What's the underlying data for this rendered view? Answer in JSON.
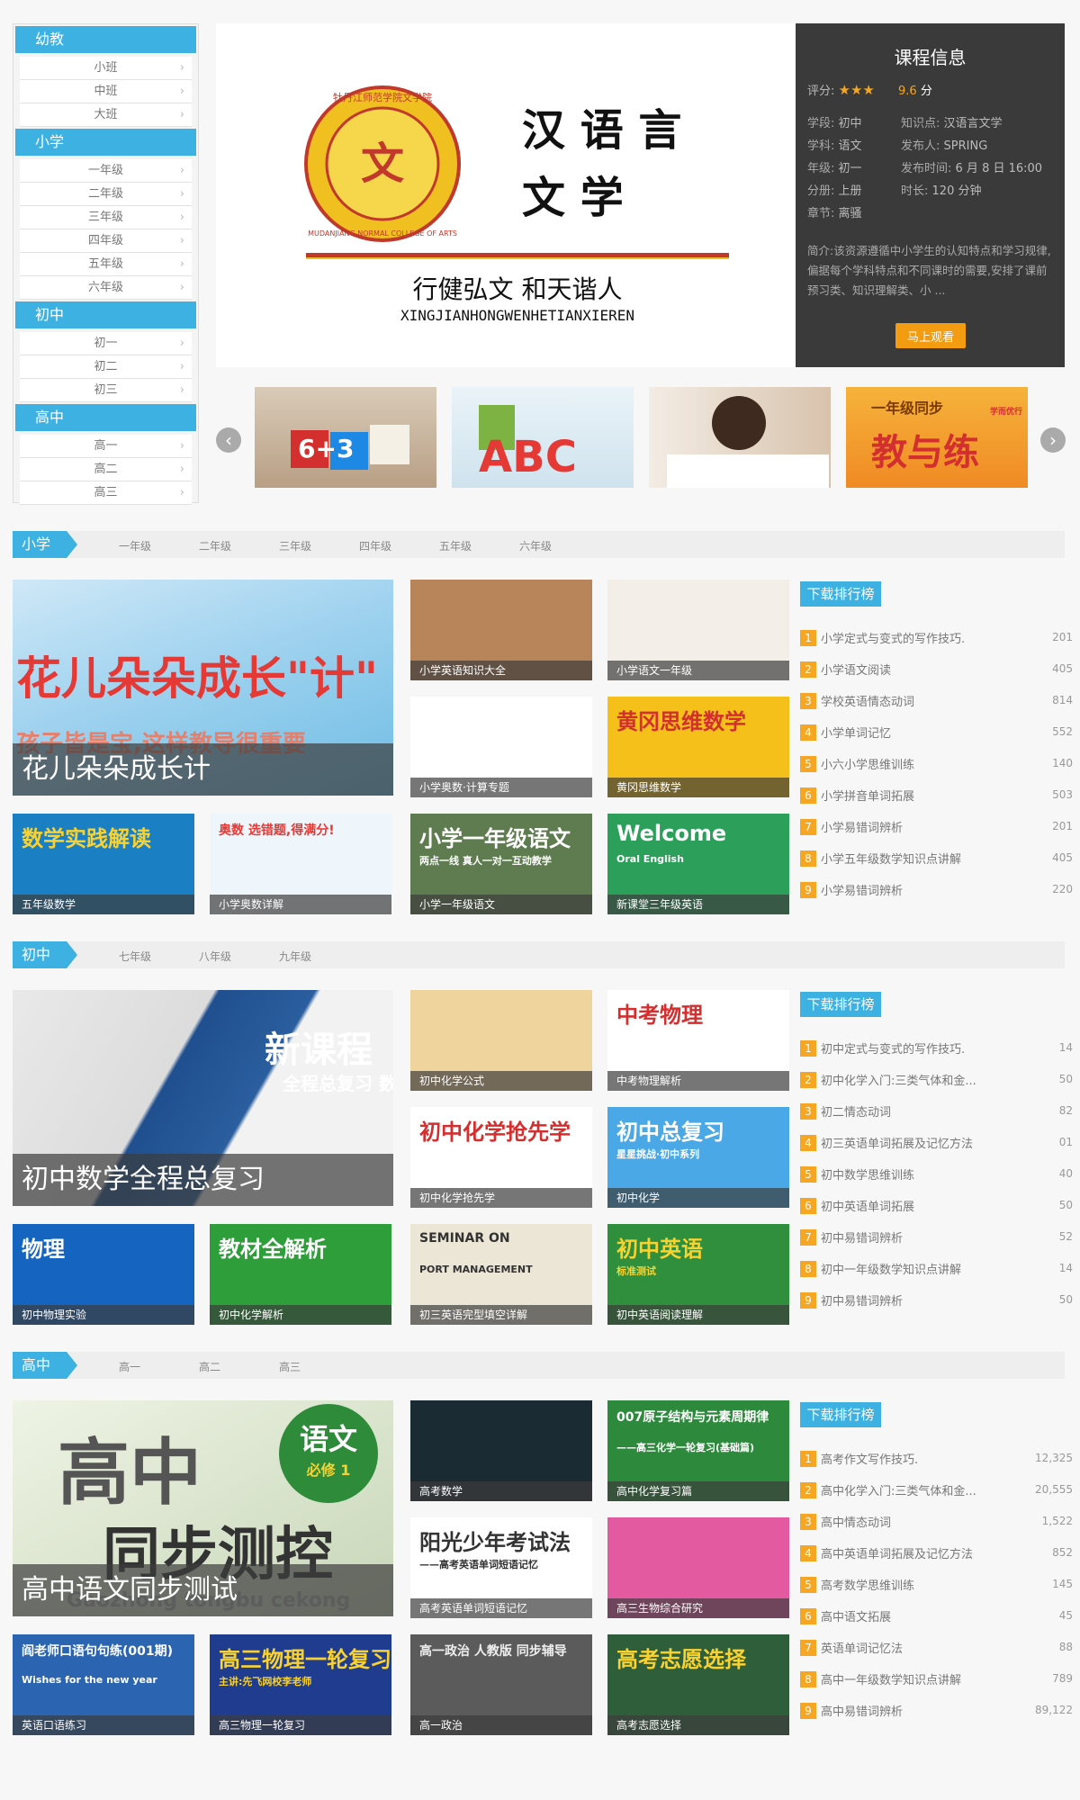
{
  "sidebar": {
    "groups": [
      {
        "title": "幼教",
        "items": [
          "小班",
          "中班",
          "大班"
        ]
      },
      {
        "title": "小学",
        "items": [
          "一年级",
          "二年级",
          "三年级",
          "四年级",
          "五年级",
          "六年级"
        ]
      },
      {
        "title": "初中",
        "items": [
          "初一",
          "初二",
          "初三"
        ]
      },
      {
        "title": "高中",
        "items": [
          "高一",
          "高二",
          "高三"
        ]
      }
    ]
  },
  "banner": {
    "seal_text": "牡丹江师范学院文学院",
    "seal_en": "MUDANJIANG NORMAL COLLEGE OF ARTS",
    "title_line1": "汉 语 言",
    "title_line2": "文      学",
    "motto": "行健弘文 和天谐人",
    "motto_pinyin": "XINGJIANHONGWENHETIANXIEREN"
  },
  "course": {
    "title": "课程信息",
    "rating_label": "评分:",
    "stars": "★★★",
    "score": "9.6",
    "score_unit": "分",
    "stage_label": "学段:",
    "stage": "初中",
    "topic_label": "知识点:",
    "topic": "汉语言文学",
    "subject_label": "学科:",
    "subject": "语文",
    "publisher_label": "发布人:",
    "publisher": "SPRING",
    "grade_label": "年级:",
    "grade": "初一",
    "time_label": "发布时间:",
    "time": "6 月 8 日 16:00",
    "volume_label": "分册:",
    "volume": "上册",
    "duration_label": "时长:",
    "duration": "120 分钟",
    "chapter_label": "章节:",
    "chapter": "离骚",
    "intro": "简介:该资源遵循中小学生的认知特点和学习规律,偏据每个学科特点和不同课时的需要,安排了课前预习类、知识理解类、小 ...",
    "watch_label": "马上观看"
  },
  "thumbs": [
    {
      "label": "6+3",
      "note": "积木"
    },
    {
      "label": "ABC",
      "note": "字母"
    },
    {
      "label": "",
      "note": "女孩"
    },
    {
      "label": "教与练",
      "badge": "一年级同步",
      "logo": "学而优行"
    }
  ],
  "sections": [
    {
      "tag": "小学",
      "tabs": [
        "一年级",
        "二年级",
        "三年级",
        "四年级",
        "五年级",
        "六年级"
      ],
      "big": {
        "art": "花儿朵朵成长\"计\"",
        "art_sub": "孩子皆是宝,这样教导很重要",
        "caption": "花儿朵朵成长计"
      },
      "cards": [
        {
          "caption": "小学英语知识大全",
          "art": ""
        },
        {
          "caption": "小学语文一年级",
          "art": ""
        },
        {
          "caption": "小学奥数·计算专题",
          "art": ""
        },
        {
          "caption": "黄冈思维数学",
          "art": "黄冈思维数学"
        },
        {
          "caption": "五年级数学",
          "art": "数学实践解读"
        },
        {
          "caption": "小学奥数详解",
          "art": "奥数 选错题,得满分!"
        },
        {
          "caption": "小学一年级语文",
          "art": "小学一年级语文",
          "art_sub": "两点一线 真人一对一互动教学"
        },
        {
          "caption": "新课堂三年级英语",
          "art": "Welcome",
          "art_sub": "Oral English"
        }
      ],
      "rank_title": "下载排行榜",
      "rank": [
        {
          "name": "小学定式与变式的写作技巧.",
          "count": "201"
        },
        {
          "name": "小学语文阅读",
          "count": "405"
        },
        {
          "name": "学校英语情态动词",
          "count": "814"
        },
        {
          "name": "小学单词记忆",
          "count": "552"
        },
        {
          "name": "小六小学思维训练",
          "count": "140"
        },
        {
          "name": "小学拼音单词拓展",
          "count": "503"
        },
        {
          "name": "小学易错词辨析",
          "count": "201"
        },
        {
          "name": "小学五年级数学知识点讲解",
          "count": "405"
        },
        {
          "name": "小学易错词辨析",
          "count": "220"
        }
      ]
    },
    {
      "tag": "初中",
      "tabs": [
        "七年级",
        "八年级",
        "九年级"
      ],
      "big": {
        "art": "新课程",
        "art_sub": "全程总复习 数学",
        "caption": "初中数学全程总复习"
      },
      "cards": [
        {
          "caption": "初中化学公式",
          "art": ""
        },
        {
          "caption": "中考物理解析",
          "art": "中考物理"
        },
        {
          "caption": "初中化学抢先学",
          "art": "初中化学抢先学"
        },
        {
          "caption": "初中化学",
          "art": "初中总复习",
          "art_sub": "星星挑战·初中系列"
        },
        {
          "caption": "初中物理实验",
          "art": "物理"
        },
        {
          "caption": "初中化学解析",
          "art": "教材全解析"
        },
        {
          "caption": "初三英语完型填空详解",
          "art": "SEMINAR ON",
          "art_sub": "PORT MANAGEMENT"
        },
        {
          "caption": "初中英语阅读理解",
          "art": "初中英语",
          "art_sub": "标准测试"
        }
      ],
      "rank_title": "下载排行榜",
      "rank": [
        {
          "name": "初中定式与变式的写作技巧.",
          "count": "14"
        },
        {
          "name": "初中化学入门:三类气体和金...",
          "count": "50"
        },
        {
          "name": "初二情态动词",
          "count": "82"
        },
        {
          "name": "初三英语单词拓展及记忆方法",
          "count": "01"
        },
        {
          "name": "初中数学思维训练",
          "count": "40"
        },
        {
          "name": "初中英语单词拓展",
          "count": "50"
        },
        {
          "name": "初中易错词辨析",
          "count": "52"
        },
        {
          "name": "初中一年级数学知识点讲解",
          "count": "14"
        },
        {
          "name": "初中易错词辨析",
          "count": "50"
        }
      ]
    },
    {
      "tag": "高中",
      "tabs": [
        "高一",
        "高二",
        "高三"
      ],
      "big": {
        "art": "高中",
        "art_badge": "语文",
        "art_badge2": "必修 1",
        "art_sub": "同步测控",
        "art_pinyin": "Gaozhong tongbu cekong",
        "caption": "高中语文同步测试"
      },
      "cards": [
        {
          "caption": "高考数学",
          "art": ""
        },
        {
          "caption": "高中化学复习篇",
          "art": "007原子结构与元素周期律",
          "art_sub": "——高三化学一轮复习(基础篇)"
        },
        {
          "caption": "高考英语单词短语记忆",
          "art": "阳光少年考试法",
          "art_sub": "——高考英语单词短语记忆"
        },
        {
          "caption": "高三生物综合研究",
          "art": ""
        },
        {
          "caption": "英语口语练习",
          "art": "阎老师口语句句练(001期)",
          "art_sub": "Wishes for the new year"
        },
        {
          "caption": "高三物理一轮复习",
          "art": "高三物理一轮复习",
          "art_sub": "主讲:先飞网校李老师"
        },
        {
          "caption": "高一政治",
          "art": "高一政治 人教版 同步辅导"
        },
        {
          "caption": "高考志愿选择",
          "art": "高考志愿选择"
        }
      ],
      "rank_title": "下载排行榜",
      "rank": [
        {
          "name": "高考作文写作技巧.",
          "count": "12,325"
        },
        {
          "name": "高中化学入门:三类气体和金...",
          "count": "20,555"
        },
        {
          "name": "高中情态动词",
          "count": "1,522"
        },
        {
          "name": "高中英语单词拓展及记忆方法",
          "count": "852"
        },
        {
          "name": "高考数学思维训练",
          "count": "145"
        },
        {
          "name": "高中语文拓展",
          "count": "45"
        },
        {
          "name": "英语单词记忆法",
          "count": "88"
        },
        {
          "name": "高中一年级数学知识点讲解",
          "count": "789"
        },
        {
          "name": "高中易错词辨析",
          "count": "89,122"
        }
      ]
    }
  ]
}
